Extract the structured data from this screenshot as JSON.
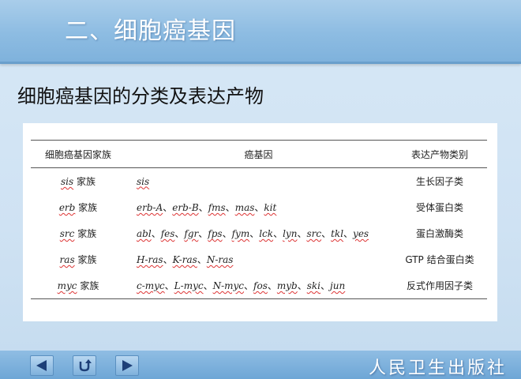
{
  "header": {
    "title": "二、细胞癌基因"
  },
  "subtitle": "细胞癌基因的分类及表达产物",
  "table": {
    "headers": [
      "细胞癌基因家族",
      "癌基因",
      "表达产物类别"
    ],
    "rows": [
      {
        "family_name": "sis",
        "family_suffix": "家族",
        "genes": [
          "sis"
        ],
        "product": "生长因子类"
      },
      {
        "family_name": "erb",
        "family_suffix": "家族",
        "genes": [
          "erb-A",
          "erb-B",
          "fms",
          "mas",
          "kit"
        ],
        "product": "受体蛋白类"
      },
      {
        "family_name": "src",
        "family_suffix": "家族",
        "genes": [
          "abl",
          "fes",
          "fgr",
          "fps",
          "fym",
          "lck",
          "lyn",
          "src",
          "tkl",
          "yes"
        ],
        "product": "蛋白激酶类"
      },
      {
        "family_name": "ras",
        "family_suffix": "家族",
        "genes": [
          "H-ras",
          "K-ras",
          "N-ras"
        ],
        "product": "GTP 结合蛋白类"
      },
      {
        "family_name": "myc",
        "family_suffix": "家族",
        "genes": [
          "c-myc",
          "L-myc",
          "N-myc",
          "fos",
          "myb",
          "ski",
          "jun"
        ],
        "product": "反式作用因子类"
      }
    ]
  },
  "separator": "、",
  "footer": {
    "publisher": "人民卫生出版社",
    "icons": {
      "prev": "arrow-left-icon",
      "return": "return-icon",
      "next": "arrow-right-icon"
    }
  },
  "colors": {
    "header": "#8dbce2",
    "background": "#cfe2f3",
    "navbar": "#6ea6d6",
    "squiggle": "#dd3333"
  }
}
